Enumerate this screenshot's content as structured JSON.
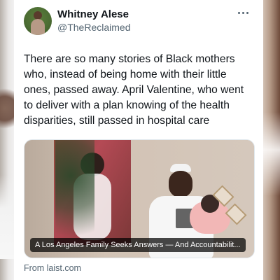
{
  "tweet": {
    "display_name": "Whitney Alese",
    "handle": "@TheReclaimed",
    "text": "There are so many stories of Black mothers who, instead of being home with their little ones, passed away. April Valentine, who went to deliver with a plan knowing of the health disparities, still passed in hospital care",
    "link_card": {
      "title": "A Los Angeles Family Seeks Answers — And Accountabilit...",
      "source_text": "From laist.com"
    }
  },
  "icons": {
    "more": "more-horizontal-icon"
  },
  "colors": {
    "text_primary": "#0f1419",
    "text_secondary": "#536471",
    "card_background": "#ffffff"
  }
}
